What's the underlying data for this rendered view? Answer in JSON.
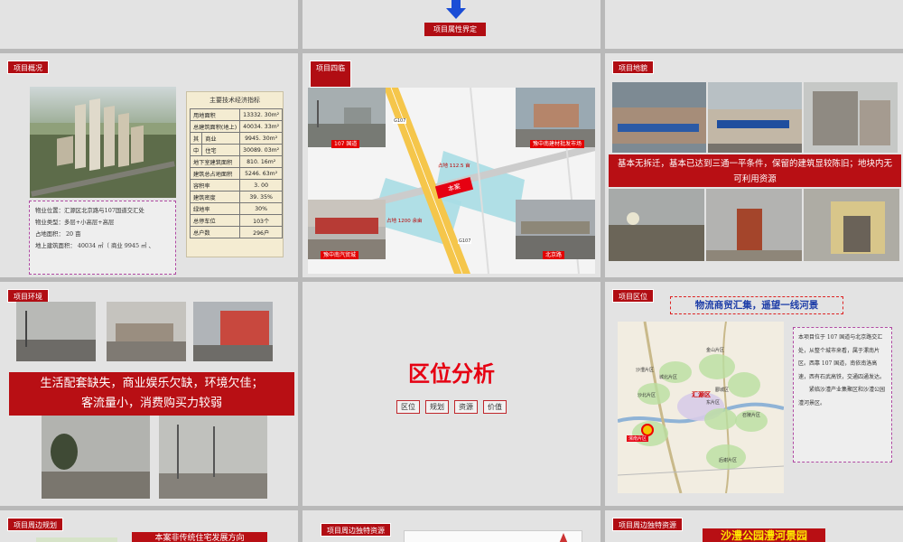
{
  "top_center": {
    "label": "项目属性界定",
    "arrow_icon": "down-arrow-icon"
  },
  "slide_overview": {
    "tag": "项目概况",
    "table_title": "主要技术经济指标",
    "rows": [
      {
        "a": "用地面积",
        "b": "",
        "v": "13332. 30m²"
      },
      {
        "a": "总建筑面积(地上)",
        "b": "",
        "v": "40034. 33m²"
      },
      {
        "a": "其",
        "b": "商业",
        "v": "9945. 30m²"
      },
      {
        "a": "中",
        "b": "住宅",
        "v": "30089. 03m²"
      },
      {
        "a": "地下室建筑面积",
        "b": "",
        "v": "810. 16m²"
      },
      {
        "a": "建筑总占地面积",
        "b": "",
        "v": "5246. 63m²"
      },
      {
        "a": "容积率",
        "b": "",
        "v": "3. 00"
      },
      {
        "a": "建筑密度",
        "b": "",
        "v": "39. 35%"
      },
      {
        "a": "绿地率",
        "b": "",
        "v": "30%"
      },
      {
        "a": "总停车位",
        "b": "",
        "v": "103个"
      },
      {
        "a": "总户数",
        "b": "",
        "v": "296户"
      }
    ],
    "info_lines": [
      "物业位置：汇源区北京路与107国道交汇处",
      "物业类型：多层+小高层+高层",
      "占地面积： 20 亩",
      "地上建筑面积： 40034 ㎡（ 商业 9945 ㎡ 、"
    ]
  },
  "slide_surround": {
    "tag": "项目四临",
    "captions": [
      "107 国道",
      "豫中南建材批发市场",
      "豫中南汽贸城",
      "北京路"
    ],
    "map_main": "本案",
    "map_labels": [
      "占地 112.5 亩",
      "占地 1200 余亩",
      "G107",
      "G107"
    ]
  },
  "slide_land": {
    "tag": "项目地貌",
    "bar_text": "基本无拆迁，基本已达到三通一平条件，保留的建筑显较陈旧；地块内无可利用资源"
  },
  "slide_env": {
    "tag": "项目环境",
    "bar_line1": "生活配套缺失，商业娱乐欠缺，环境欠佳；",
    "bar_line2": "客流量小，消费购买力较弱"
  },
  "slide_analysis": {
    "title": "区位分析",
    "chips": [
      "区位",
      "规划",
      "资源",
      "价值"
    ]
  },
  "slide_location": {
    "tag": "项目区位",
    "headline": "物流商贸汇集，遥望一线河景",
    "text": [
      "本项目位于 107 国道与北京路交汇处，从整个城市来看，属于漯南片区。西靠 107 国道，南依南洛高速，西有石武高铁，交通四通发达。",
      "紧临沙澧产业集聚区和沙澧公园澧河景区。"
    ],
    "map_labels": [
      "金山片区",
      "城北片区",
      "沙澧片区",
      "汇源区",
      "东片区",
      "郾城区",
      "漯南片区",
      "召陵片区",
      "后谢片区",
      "沙北片区"
    ]
  },
  "slide_plan": {
    "tag": "项目周边规划",
    "bar_text": "本案非传统住宅发展方向"
  },
  "slide_resource1": {
    "tag": "项目周边独特资源"
  },
  "slide_resource2": {
    "tag": "项目周边独特资源",
    "headline": "沙澧公园澧河景园"
  },
  "colors": {
    "brand_red": "#b10d13",
    "bright_red": "#e60012",
    "blue_arrow": "#1a4dd6"
  }
}
